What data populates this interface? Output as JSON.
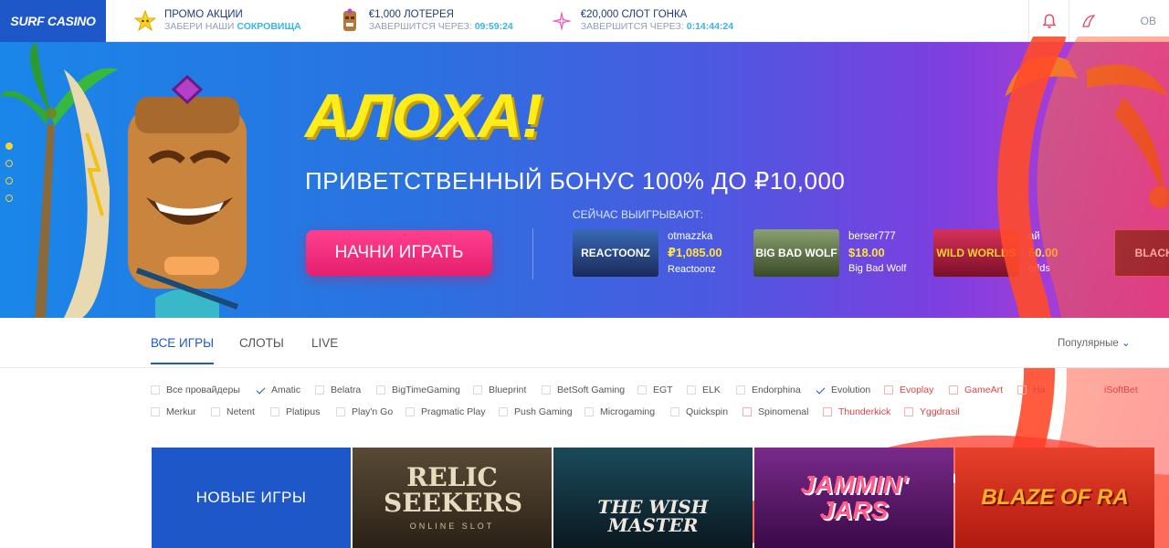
{
  "logo": {
    "text": "SURF CASINO"
  },
  "promos": [
    {
      "title": "ПРОМО АКЦИИ",
      "sub_prefix": "ЗАБЕРИ НАШИ",
      "sub_value": "СОКРОВИЩА",
      "icon": "star-icon"
    },
    {
      "title": "€1,000 ЛОТЕРЕЯ",
      "sub_prefix": "ЗАВЕРШИТСЯ ЧЕРЕЗ:",
      "sub_value": "09:59:24",
      "icon": "tiki-icon"
    },
    {
      "title": "€20,000 СЛОТ ГОНКА",
      "sub_prefix": "ЗАВЕРШИТСЯ ЧЕРЕЗ:",
      "sub_value": "0:14:44:24",
      "icon": "sparkle-icon"
    }
  ],
  "topbar": {
    "login_fragment": "ОВ"
  },
  "hero": {
    "title": "АЛОХА!",
    "subtitle": "ПРИВЕТСТВЕННЫЙ БОНУС 100% ДО ₽10,000",
    "cta": "НАЧНИ ИГРАТЬ",
    "winners_label": "СЕЙЧАС ВЫИГРЫВАЮТ:",
    "winners": [
      {
        "user": "otmazzka",
        "amount": "₽1,085.00",
        "game": "Reactoonz",
        "thumb_text": "REACTOONZ"
      },
      {
        "user": "berser777",
        "amount": "$18.00",
        "game": "Big Bad Wolf",
        "thumb_text": "BIG BAD WOLF"
      },
      {
        "user": "ай",
        "amount": "50.00",
        "game": "orlds",
        "thumb_text": "WILD WORLDS"
      },
      {
        "user": "",
        "amount": "",
        "game": "",
        "thumb_text": "BLACKJ"
      }
    ]
  },
  "tabs": [
    {
      "label": "ВСЕ ИГРЫ",
      "active": true
    },
    {
      "label": "СЛОТЫ",
      "active": false
    },
    {
      "label": "LIVE",
      "active": false
    }
  ],
  "sort": {
    "label": "Популярные"
  },
  "providers_row1": [
    {
      "label": "Все провайдеры",
      "checked": false,
      "red": false
    },
    {
      "label": "Amatic",
      "checked": true,
      "red": false
    },
    {
      "label": "Belatra",
      "checked": false,
      "red": false
    },
    {
      "label": "BigTimeGaming",
      "checked": false,
      "red": false
    },
    {
      "label": "Blueprint",
      "checked": false,
      "red": false
    },
    {
      "label": "BetSoft Gaming",
      "checked": false,
      "red": false
    },
    {
      "label": "EGT",
      "checked": false,
      "red": false
    },
    {
      "label": "ELK",
      "checked": false,
      "red": false
    },
    {
      "label": "Endorphina",
      "checked": false,
      "red": false
    },
    {
      "label": "Evolution",
      "checked": true,
      "red": false
    },
    {
      "label": "Evoplay",
      "checked": false,
      "red": true
    },
    {
      "label": "GameArt",
      "checked": false,
      "red": true
    },
    {
      "label": "Ha",
      "checked": false,
      "red": true
    },
    {
      "label": "iSoftBet",
      "checked": false,
      "red": true
    }
  ],
  "providers_row2": [
    {
      "label": "Merkur",
      "checked": false,
      "red": false
    },
    {
      "label": "Netent",
      "checked": false,
      "red": false
    },
    {
      "label": "Platipus",
      "checked": false,
      "red": false
    },
    {
      "label": "Play'n Go",
      "checked": false,
      "red": false
    },
    {
      "label": "Pragmatic Play",
      "checked": false,
      "red": false
    },
    {
      "label": "Push Gaming",
      "checked": false,
      "red": false
    },
    {
      "label": "Microgaming",
      "checked": false,
      "red": false
    },
    {
      "label": "Quickspin",
      "checked": false,
      "red": false
    },
    {
      "label": "Spinomenal",
      "checked": false,
      "red": true
    },
    {
      "label": "Thunderkick",
      "checked": false,
      "red": true
    },
    {
      "label": "Yggdrasil",
      "checked": false,
      "red": true
    }
  ],
  "new_games": {
    "label": "НОВЫЕ ИГРЫ"
  },
  "games": [
    {
      "title": "RELIC SEEKERS",
      "sub": "ONLINE SLOT",
      "bg": "#3a3226"
    },
    {
      "title": "THE WISH MASTER",
      "sub": "",
      "bg": "#0e2a36"
    },
    {
      "title": "JAMMIN' JARS",
      "sub": "",
      "bg": "#5a1a6e"
    },
    {
      "title": "BLAZE OF RA",
      "sub": "",
      "bg": "#c8281e"
    }
  ],
  "colors": {
    "brand": "#1e58c8",
    "accent": "#e5206e",
    "gold": "#ffec1a",
    "info": "#38b5e6"
  }
}
